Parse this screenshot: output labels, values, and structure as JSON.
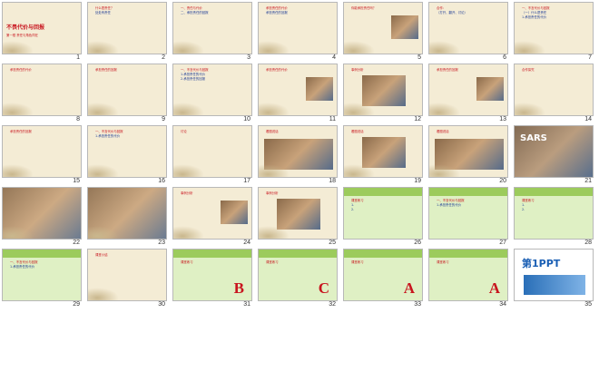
{
  "view": {
    "name": "slide-sorter"
  },
  "colors": {
    "paper": "#f4ecd5",
    "green": "#dff0c4",
    "green_band": "#9ccb5c",
    "red_text": "#c8141e",
    "blue_text": "#1e3c96",
    "dark_text": "#333333"
  },
  "slides": [
    {
      "n": "1",
      "bg": "paper",
      "title": "不畏代价与回报",
      "lines": [
        "第一框 责任与角色同在"
      ],
      "photo": null
    },
    {
      "n": "2",
      "bg": "paper",
      "title": "",
      "lines": [
        "什么是责任？",
        "处处有责任"
      ],
      "photo": null
    },
    {
      "n": "3",
      "bg": "paper",
      "title": "",
      "lines": [
        "一、责任与代价",
        "二、承担责任的回报"
      ],
      "photo": null
    },
    {
      "n": "4",
      "bg": "paper",
      "title": "",
      "lines": [
        "承担责任的代价",
        "承担责任的回报"
      ],
      "photo": null
    },
    {
      "n": "5",
      "bg": "paper",
      "title": "",
      "lines": [
        "你能承担责任吗？"
      ],
      "photo": "small"
    },
    {
      "n": "6",
      "bg": "paper",
      "title": "",
      "lines": [
        "合作：",
        "（打开、翻开、讨论）"
      ],
      "photo": null
    },
    {
      "n": "7",
      "bg": "paper",
      "title": "",
      "lines": [
        "一、不言代价与回报",
        "（一）什么是责任",
        "1.承担责任的代价"
      ],
      "photo": null
    },
    {
      "n": "8",
      "bg": "paper",
      "title": "",
      "lines": [
        "承担责任的代价"
      ],
      "photo": null
    },
    {
      "n": "9",
      "bg": "paper",
      "title": "",
      "lines": [
        "承担责任的回报"
      ],
      "photo": null
    },
    {
      "n": "10",
      "bg": "paper",
      "title": "",
      "lines": [
        "一、不言代价与回报",
        "1.承担责任的代价",
        "2.承担责任的回报"
      ],
      "photo": null
    },
    {
      "n": "11",
      "bg": "paper",
      "title": "",
      "lines": [
        "承担责任的代价"
      ],
      "photo": "small"
    },
    {
      "n": "12",
      "bg": "paper",
      "title": "",
      "lines": [
        "事例分析"
      ],
      "photo": "wide"
    },
    {
      "n": "13",
      "bg": "paper",
      "title": "",
      "lines": [
        "承担责任的回报"
      ],
      "photo": "small"
    },
    {
      "n": "14",
      "bg": "paper",
      "title": "",
      "lines": [
        "合作探究"
      ],
      "photo": null
    },
    {
      "n": "15",
      "bg": "paper",
      "title": "",
      "lines": [
        "承担责任的回报"
      ],
      "photo": null
    },
    {
      "n": "16",
      "bg": "paper",
      "title": "",
      "lines": [
        "一、不言代价与回报",
        "1.承担责任的代价"
      ],
      "photo": null
    },
    {
      "n": "17",
      "bg": "paper",
      "title": "",
      "lines": [
        "讨论"
      ],
      "photo": null
    },
    {
      "n": "18",
      "bg": "paper",
      "title": "",
      "lines": [
        "看图说话"
      ],
      "photo": "two"
    },
    {
      "n": "19",
      "bg": "paper",
      "title": "",
      "lines": [
        "看图说话"
      ],
      "photo": "wide"
    },
    {
      "n": "20",
      "bg": "paper",
      "title": "",
      "lines": [
        "看图说话"
      ],
      "photo": "two"
    },
    {
      "n": "21",
      "bg": "photo",
      "title": "SARS",
      "lines": [],
      "photo": "full"
    },
    {
      "n": "22",
      "bg": "paper",
      "title": "",
      "lines": [],
      "photo": "full"
    },
    {
      "n": "23",
      "bg": "paper",
      "title": "",
      "lines": [],
      "photo": "full"
    },
    {
      "n": "24",
      "bg": "paper",
      "title": "",
      "lines": [
        "事例分析"
      ],
      "photo": "small"
    },
    {
      "n": "25",
      "bg": "paper",
      "title": "",
      "lines": [
        "事例分析"
      ],
      "photo": "wide"
    },
    {
      "n": "26",
      "bg": "green",
      "title": "",
      "lines": [
        "课堂练习",
        "1.",
        "2."
      ],
      "photo": null
    },
    {
      "n": "27",
      "bg": "green",
      "title": "",
      "lines": [
        "一、不言代价与回报",
        "1.承担责任的代价"
      ],
      "photo": null
    },
    {
      "n": "28",
      "bg": "green",
      "title": "",
      "lines": [
        "课堂练习",
        "1.",
        "2."
      ],
      "photo": null
    },
    {
      "n": "29",
      "bg": "green",
      "title": "",
      "lines": [
        "一、不言代价与回报",
        "1.承担责任的代价"
      ],
      "photo": null
    },
    {
      "n": "30",
      "bg": "paper",
      "title": "",
      "lines": [
        "课堂小结"
      ],
      "photo": null
    },
    {
      "n": "31",
      "bg": "green",
      "title": "",
      "lines": [
        "课堂练习"
      ],
      "answer": "B",
      "photo": null
    },
    {
      "n": "32",
      "bg": "green",
      "title": "",
      "lines": [
        "课堂练习"
      ],
      "answer": "C",
      "photo": null
    },
    {
      "n": "33",
      "bg": "green",
      "title": "",
      "lines": [
        "课堂练习"
      ],
      "answer": "A",
      "photo": null
    },
    {
      "n": "34",
      "bg": "green",
      "title": "",
      "lines": [
        "课堂练习"
      ],
      "answer": "A",
      "photo": "small"
    },
    {
      "n": "35",
      "bg": "white",
      "title": "第1PPT",
      "lines": [],
      "photo": "logo"
    }
  ]
}
